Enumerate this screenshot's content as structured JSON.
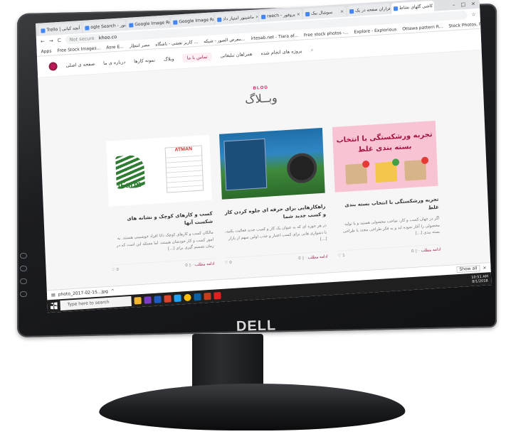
{
  "browser": {
    "tabs": [
      {
        "label": "Trello | آنچه کیانی"
      },
      {
        "label": "ogle Search - ماشینور"
      },
      {
        "label": "Google Image Resu"
      },
      {
        "label": "Google Image Resu"
      },
      {
        "label": "ماشینور امتیاز داد"
      },
      {
        "label": "raech - پروفور"
      },
      {
        "label": "سوشال بیک"
      },
      {
        "label": "هزاران صفحه در یک"
      },
      {
        "label": "کاشی گلهای نشاط"
      }
    ],
    "url": "khoo.co",
    "not_secure": "Not secure",
    "bookmarks": [
      "Apps",
      "Free Stock Images...",
      "Asre E...",
      "مصر انتظار",
      "کاربر نقشی - باشگاه ...",
      "معرض الصور - شبکه...",
      "irtesab.net - Tiara af...",
      "Free stock photos -...",
      "Explore - Explorious",
      "Ottawa pattern R...",
      "Stock Photos, Pictu..."
    ]
  },
  "site": {
    "nav": [
      "صفحه ی اصلی",
      "درباره ی ما",
      "نمونه کارها",
      "وبلاگ",
      "تماس با ما",
      "همراهان تبلیغاتی",
      "پروژه های انجام شده"
    ],
    "active_nav_index": 4,
    "blog_sub": "BLOG",
    "blog_title": "وبــلاگ"
  },
  "cards": [
    {
      "title": "کسب و کارهای کوچک و نشانه های شکست آنها",
      "excerpt": "مالکان کسب و کارهای کوچک ذاتا افراد خوشبینی هستند. به امور کسب و کار خودشان هستند، اما مسئله این است که در زمان تصمیم گیری برای [...]",
      "comments": "0",
      "likes": "0",
      "more": "ادامه مطلب",
      "image": "iFarm",
      "badge": "ATMAN"
    },
    {
      "title": "راهکارهایی برای حرفه ای جلوه کردن کار و کسب جدید شما",
      "excerpt": "در هر حوزه ای که به عنوان یک کار و کسب جدید فعالیت بکنید، با دشواری هایی برای کسب اعتبار و جذب اولین سهم از بازار [...]",
      "comments": "0",
      "likes": "0",
      "more": "ادامه مطلب",
      "image": "tractor"
    },
    {
      "title": "تجربه ورشکستگی با انتخاب بسته بندی غلط",
      "excerpt": "اگر در جهان کسب و کار، صاحب محصولی هستید و یا تولید محصولی را آغاز نموده اید و به فکر طراحی مجدد یا طراحی بسته بندی [...]",
      "comments": "0",
      "likes": "1",
      "more": "ادامه مطلب",
      "image_text": "تجربه ورشکستگی با انتخاب بسته بندی غلط"
    }
  ],
  "download": {
    "file": "photo_2017-02-15...jpg",
    "show_all": "Show all"
  },
  "taskbar": {
    "search_placeholder": "Type here to search",
    "time": "10:51 AM",
    "date": "8/1/2018"
  },
  "monitor": {
    "brand": "DELL"
  }
}
